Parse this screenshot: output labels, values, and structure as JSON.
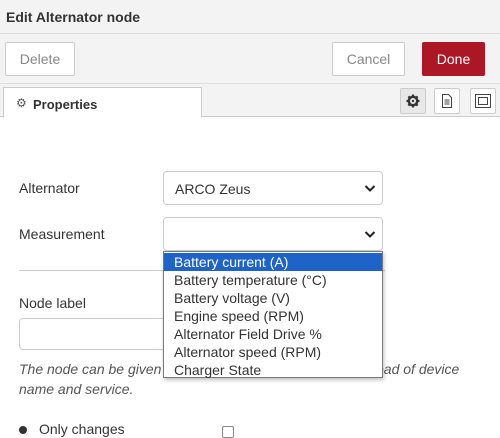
{
  "header": {
    "title": "Edit Alternator node"
  },
  "toolbar": {
    "delete_label": "Delete",
    "cancel_label": "Cancel",
    "done_label": "Done"
  },
  "tabs": [
    {
      "label": "Properties",
      "icon": "gear-icon"
    }
  ],
  "tab_tools": [
    "settings-icon",
    "document-icon",
    "frame-icon"
  ],
  "form": {
    "alternator": {
      "label": "Alternator",
      "value": "ARCO Zeus"
    },
    "measurement": {
      "label": "Measurement",
      "value": "",
      "options": [
        "Battery current (A)",
        "Battery temperature (°C)",
        "Battery voltage (V)",
        "Engine speed (RPM)",
        "Alternator Field Drive %",
        "Alternator speed (RPM)",
        "Charger State"
      ],
      "highlighted": "Battery current (A)"
    },
    "node_label": {
      "label": "Node label",
      "value": ""
    },
    "help_line1": "The node can be given",
    "help_line1_end": "ead of device",
    "help_line2": "name and service.",
    "only_changes": {
      "label": "Only changes",
      "checked": false
    }
  },
  "colors": {
    "done_button": "#ad1625",
    "highlight": "#1e64c8"
  }
}
